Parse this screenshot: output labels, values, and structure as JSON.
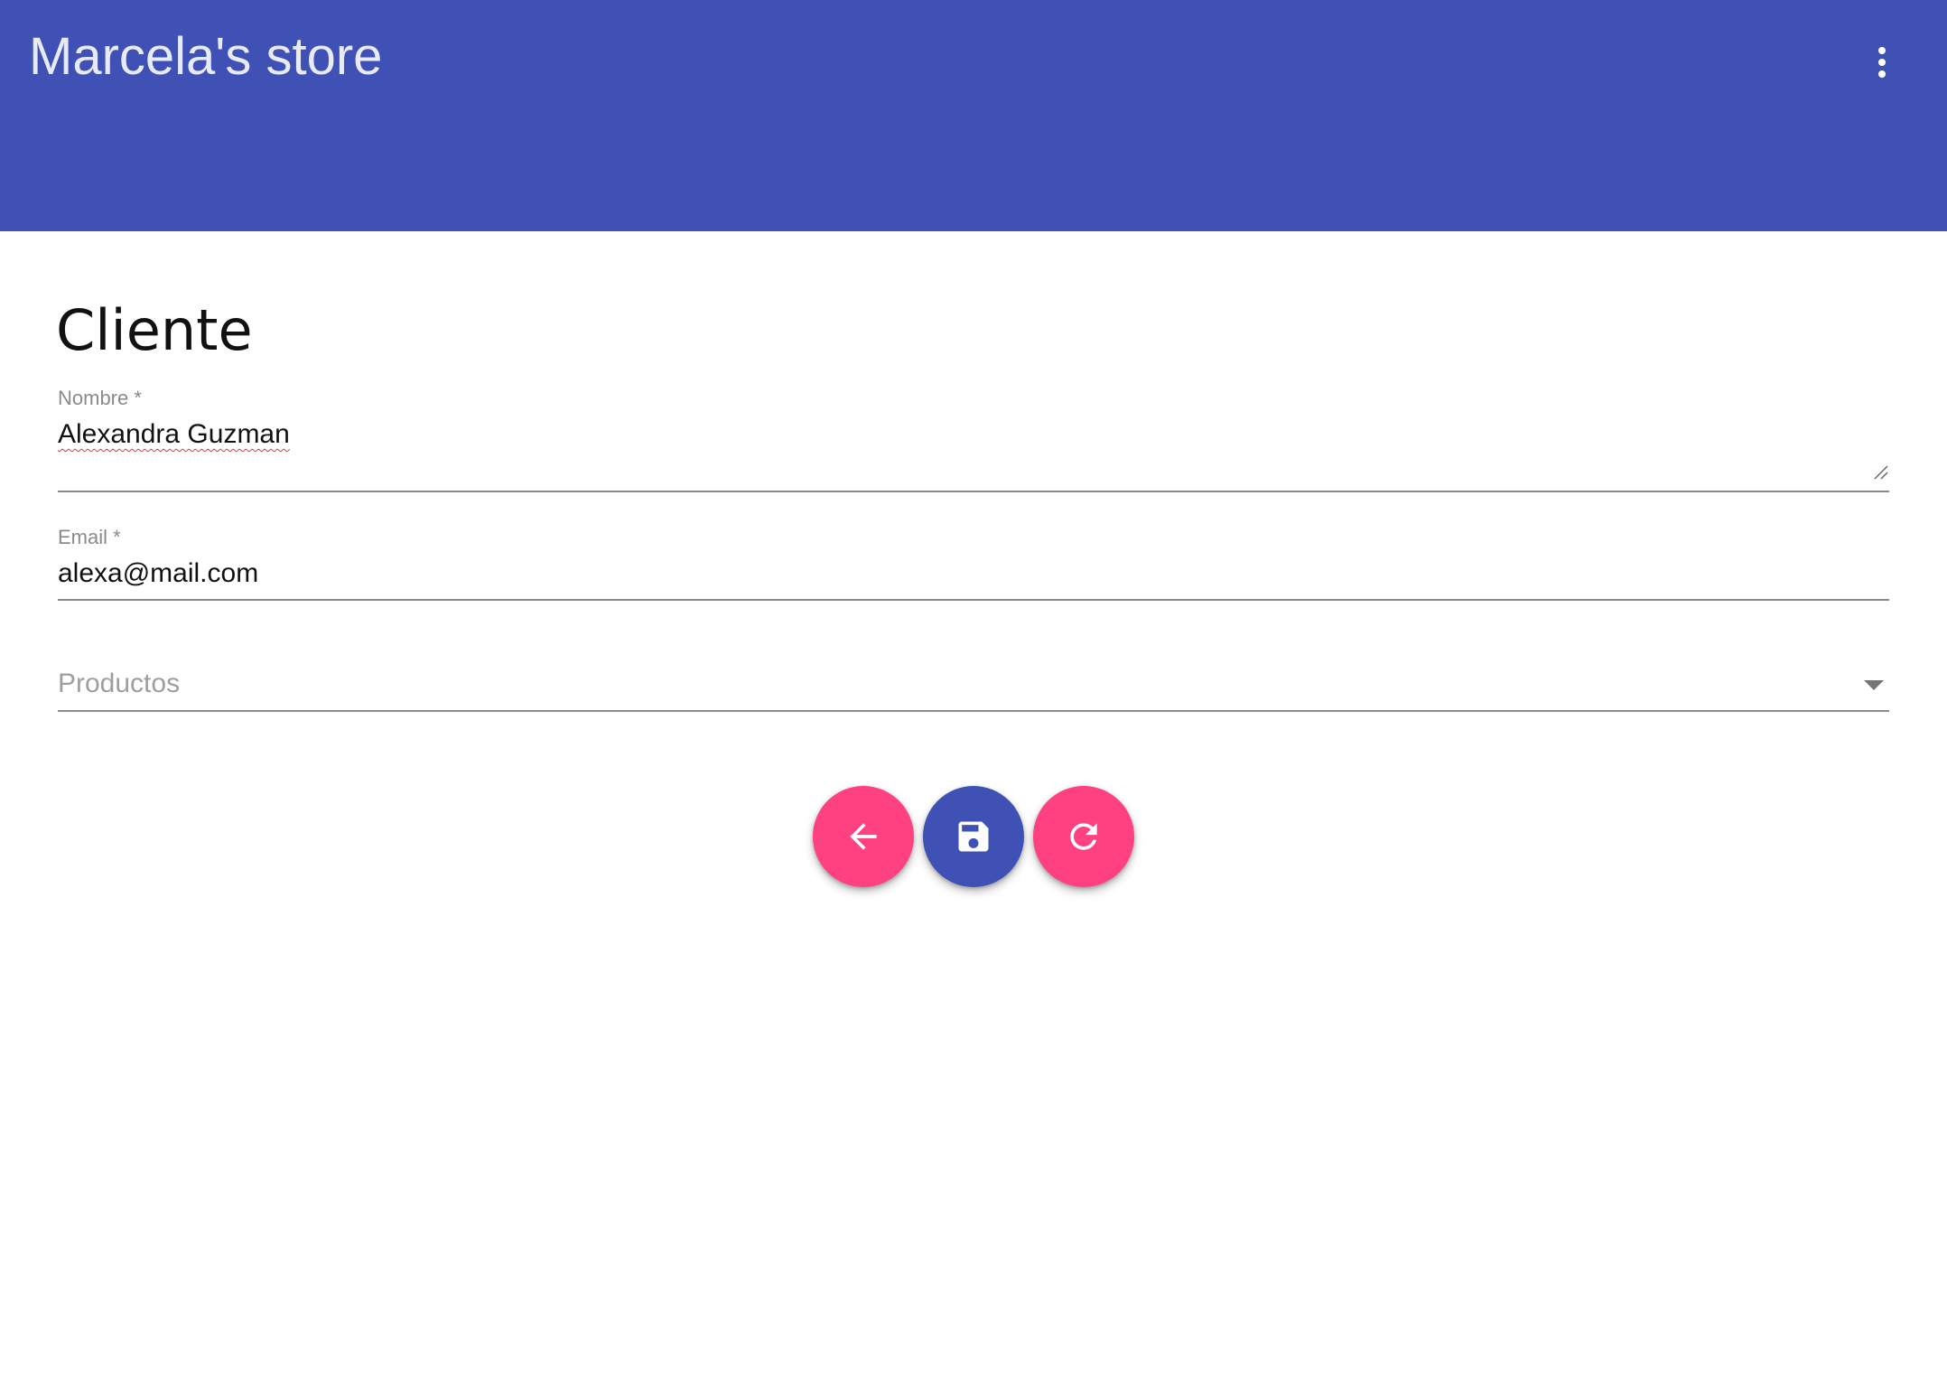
{
  "app": {
    "title": "Marcela's store",
    "colors": {
      "primary": "#3f51b5",
      "accent": "#ff4081"
    },
    "menu_icon": "more-vert-icon"
  },
  "form": {
    "heading": "Cliente",
    "nombre": {
      "label": "Nombre *",
      "value": "Alexandra Guzman"
    },
    "email": {
      "label": "Email *",
      "value": "alexa@mail.com"
    },
    "productos": {
      "placeholder": "Productos",
      "icon": "arrow-drop-down-icon"
    }
  },
  "actions": [
    {
      "name": "back",
      "icon": "arrow-back-icon",
      "color": "#ff4081"
    },
    {
      "name": "save",
      "icon": "save-icon",
      "color": "#3f51b5"
    },
    {
      "name": "refresh",
      "icon": "refresh-icon",
      "color": "#ff4081"
    }
  ]
}
